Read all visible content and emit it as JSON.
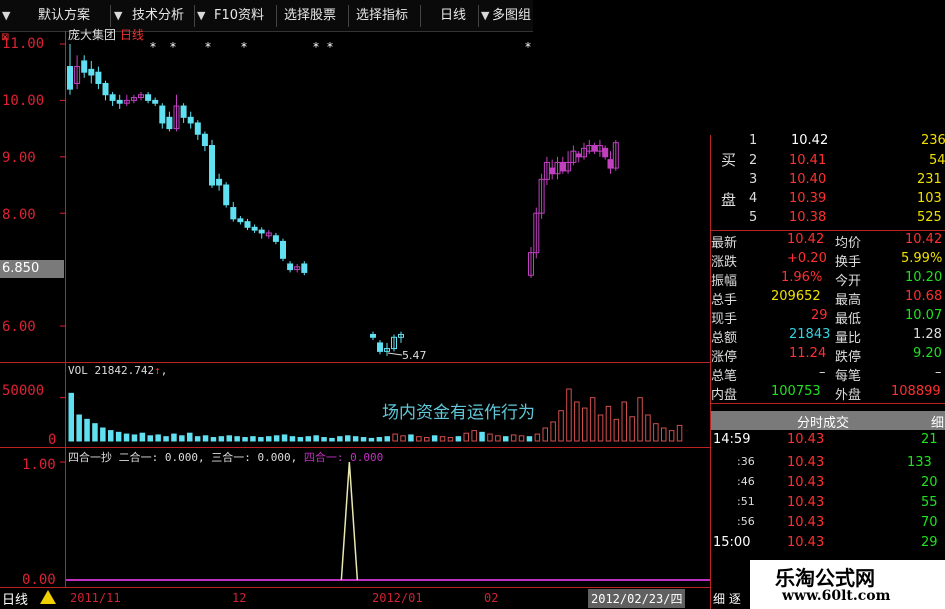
{
  "toolbar": {
    "items": [
      "默认方案",
      "技术分析",
      "F10资料",
      "选择股票",
      "选择指标",
      "日线",
      "多图组"
    ]
  },
  "stock": {
    "name": "庞大集团",
    "period": "日线"
  },
  "y_axis": {
    "labels": [
      "11.00",
      "10.00",
      "9.00",
      "8.00",
      "6.00"
    ],
    "current": "6.850"
  },
  "volume": {
    "label": "VOL 21842.742",
    "arrow": "↑",
    "comma": ",",
    "ylabels": [
      "50000",
      "0"
    ]
  },
  "indicator": {
    "title": "四合一抄",
    "f2": "二合一: 0.000,",
    "f3": "三合一: 0.000,",
    "f4": "四合一: 0.000",
    "ylabels": [
      "1.00",
      "0.00"
    ]
  },
  "annotation": "场内资金有运作行为",
  "low_label": "5.47",
  "bottom": {
    "tab": "日线",
    "dates": [
      "2011/11",
      "12",
      "2012/01",
      "02"
    ],
    "current_date": "2012/02/23/四"
  },
  "orderbook": {
    "buy_label_1": "买",
    "buy_label_2": "盘",
    "rows": [
      {
        "n": "1",
        "p": "10.42",
        "v": "236"
      },
      {
        "n": "2",
        "p": "10.41",
        "v": "54"
      },
      {
        "n": "3",
        "p": "10.40",
        "v": "231"
      },
      {
        "n": "4",
        "p": "10.39",
        "v": "103"
      },
      {
        "n": "5",
        "p": "10.38",
        "v": "525"
      }
    ]
  },
  "quote": [
    {
      "l1": "最新",
      "v1": "10.42",
      "l2": "均价",
      "v2": "10.42"
    },
    {
      "l1": "涨跌",
      "v1": "+0.20",
      "l2": "换手",
      "v2": "5.99%"
    },
    {
      "l1": "振幅",
      "v1": "1.96%",
      "l2": "今开",
      "v2": "10.20"
    },
    {
      "l1": "总手",
      "v1": "209652",
      "l2": "最高",
      "v2": "10.68"
    },
    {
      "l1": "现手",
      "v1": "29",
      "l2": "最低",
      "v2": "10.07"
    },
    {
      "l1": "总额",
      "v1": "21843",
      "l2": "量比",
      "v2": "1.28"
    },
    {
      "l1": "涨停",
      "v1": "11.24",
      "l2": "跌停",
      "v2": "9.20"
    },
    {
      "l1": "总笔",
      "v1": "–",
      "l2": "每笔",
      "v2": "–"
    },
    {
      "l1": "内盘",
      "v1": "100753",
      "l2": "外盘",
      "v2": "108899"
    }
  ],
  "trades_header": "分时成交",
  "trades_btn": "细",
  "trades": [
    {
      "t": "14:59",
      "p": "10.43",
      "v": "21"
    },
    {
      "t": ":36",
      "p": "10.43",
      "v": "133"
    },
    {
      "t": ":46",
      "p": "10.43",
      "v": "20"
    },
    {
      "t": ":51",
      "p": "10.43",
      "v": "55"
    },
    {
      "t": ":56",
      "p": "10.43",
      "v": "70"
    },
    {
      "t": "15:00",
      "p": "10.43",
      "v": "29"
    }
  ],
  "watermark": {
    "line1": "乐淘公式网",
    "line2": "www.60lt.com"
  },
  "foot": {
    "a": "细",
    "b": "逐"
  },
  "chart_data": {
    "type": "candlestick",
    "price_ylim": [
      5.0,
      11.0
    ],
    "candles": [
      {
        "o": 10.6,
        "c": 10.2,
        "h": 11.0,
        "l": 10.1
      },
      {
        "o": 10.3,
        "c": 10.6,
        "h": 10.8,
        "l": 10.2
      },
      {
        "o": 10.7,
        "c": 10.5,
        "h": 10.8,
        "l": 10.4
      },
      {
        "o": 10.55,
        "c": 10.45,
        "h": 10.7,
        "l": 10.3
      },
      {
        "o": 10.5,
        "c": 10.3,
        "h": 10.6,
        "l": 10.2
      },
      {
        "o": 10.3,
        "c": 10.1,
        "h": 10.35,
        "l": 10.0
      },
      {
        "o": 10.1,
        "c": 10.0,
        "h": 10.15,
        "l": 9.9
      },
      {
        "o": 10.0,
        "c": 9.95,
        "h": 10.1,
        "l": 9.85
      },
      {
        "o": 9.95,
        "c": 10.0,
        "h": 10.1,
        "l": 9.9
      },
      {
        "o": 10.0,
        "c": 10.05,
        "h": 10.1,
        "l": 9.95
      },
      {
        "o": 10.05,
        "c": 10.1,
        "h": 10.15,
        "l": 10.0
      },
      {
        "o": 10.1,
        "c": 10.0,
        "h": 10.15,
        "l": 9.95
      },
      {
        "o": 10.0,
        "c": 9.95,
        "h": 10.05,
        "l": 9.9
      },
      {
        "o": 9.9,
        "c": 9.6,
        "h": 9.95,
        "l": 9.5
      },
      {
        "o": 9.7,
        "c": 9.5,
        "h": 9.8,
        "l": 9.45
      },
      {
        "o": 9.5,
        "c": 9.9,
        "h": 10.1,
        "l": 9.45
      },
      {
        "o": 9.9,
        "c": 9.7,
        "h": 9.95,
        "l": 9.6
      },
      {
        "o": 9.7,
        "c": 9.6,
        "h": 9.8,
        "l": 9.5
      },
      {
        "o": 9.6,
        "c": 9.4,
        "h": 9.65,
        "l": 9.3
      },
      {
        "o": 9.4,
        "c": 9.2,
        "h": 9.45,
        "l": 9.1
      },
      {
        "o": 9.2,
        "c": 8.5,
        "h": 9.3,
        "l": 8.45
      },
      {
        "o": 8.6,
        "c": 8.5,
        "h": 8.7,
        "l": 8.4
      },
      {
        "o": 8.5,
        "c": 8.15,
        "h": 8.55,
        "l": 8.1
      },
      {
        "o": 8.1,
        "c": 7.9,
        "h": 8.2,
        "l": 7.85
      },
      {
        "o": 7.9,
        "c": 7.85,
        "h": 7.95,
        "l": 7.8
      },
      {
        "o": 7.85,
        "c": 7.75,
        "h": 7.9,
        "l": 7.7
      },
      {
        "o": 7.75,
        "c": 7.7,
        "h": 7.8,
        "l": 7.65
      },
      {
        "o": 7.7,
        "c": 7.65,
        "h": 7.75,
        "l": 7.55
      },
      {
        "o": 7.6,
        "c": 7.65,
        "h": 7.7,
        "l": 7.55
      },
      {
        "o": 7.6,
        "c": 7.5,
        "h": 7.65,
        "l": 7.45
      },
      {
        "o": 7.5,
        "c": 7.2,
        "h": 7.55,
        "l": 7.15
      },
      {
        "o": 7.1,
        "c": 7.0,
        "h": 7.15,
        "l": 6.95
      },
      {
        "o": 7.0,
        "c": 7.05,
        "h": 7.1,
        "l": 6.95
      },
      {
        "o": 7.1,
        "c": 6.95,
        "h": 7.15,
        "l": 6.9
      }
    ],
    "candles2": [
      {
        "o": 5.85,
        "c": 5.8,
        "h": 5.9,
        "l": 5.75
      },
      {
        "o": 5.7,
        "c": 5.55,
        "h": 5.75,
        "l": 5.5
      },
      {
        "o": 5.55,
        "c": 5.6,
        "h": 5.7,
        "l": 5.47
      },
      {
        "o": 5.6,
        "c": 5.8,
        "h": 5.85,
        "l": 5.55
      },
      {
        "o": 5.8,
        "c": 5.85,
        "h": 5.9,
        "l": 5.7
      }
    ],
    "candles3": [
      {
        "o": 6.9,
        "c": 7.3,
        "h": 7.4,
        "l": 6.85
      },
      {
        "o": 7.3,
        "c": 8.0,
        "h": 8.1,
        "l": 7.2
      },
      {
        "o": 8.0,
        "c": 8.6,
        "h": 8.7,
        "l": 7.9
      },
      {
        "o": 8.6,
        "c": 8.9,
        "h": 9.0,
        "l": 8.5
      },
      {
        "o": 8.8,
        "c": 8.7,
        "h": 8.95,
        "l": 8.6
      },
      {
        "o": 8.7,
        "c": 8.9,
        "h": 9.0,
        "l": 8.6
      },
      {
        "o": 8.9,
        "c": 8.75,
        "h": 9.0,
        "l": 8.7
      },
      {
        "o": 8.75,
        "c": 8.9,
        "h": 9.1,
        "l": 8.7
      },
      {
        "o": 8.9,
        "c": 9.1,
        "h": 9.2,
        "l": 8.85
      },
      {
        "o": 9.05,
        "c": 9.0,
        "h": 9.1,
        "l": 8.9
      },
      {
        "o": 9.0,
        "c": 9.15,
        "h": 9.25,
        "l": 8.95
      },
      {
        "o": 9.1,
        "c": 9.2,
        "h": 9.3,
        "l": 9.05
      },
      {
        "o": 9.2,
        "c": 9.1,
        "h": 9.25,
        "l": 9.05
      },
      {
        "o": 9.1,
        "c": 9.2,
        "h": 9.3,
        "l": 9.0
      },
      {
        "o": 9.15,
        "c": 9.0,
        "h": 9.2,
        "l": 8.95
      },
      {
        "o": 8.95,
        "c": 8.8,
        "h": 9.1,
        "l": 8.7
      },
      {
        "o": 8.8,
        "c": 9.25,
        "h": 9.3,
        "l": 8.75
      }
    ],
    "vol_ylim": [
      0,
      60000
    ],
    "volumes": [
      55000,
      30000,
      25000,
      20000,
      15000,
      12000,
      10000,
      8000,
      7000,
      9000,
      6000,
      7000,
      5000,
      8000,
      6000,
      9000,
      5000,
      6000,
      4000,
      5000,
      6000,
      5000,
      4000,
      5000,
      4000,
      5000,
      6000,
      7000,
      5000,
      4000,
      5000,
      6000,
      4000,
      3000,
      5000,
      6000,
      5000,
      4000,
      3000,
      4000,
      5000,
      8000,
      6000,
      7000,
      5000,
      4000,
      6000,
      5000,
      4000,
      5000,
      9000,
      12000,
      10000,
      8000,
      6000,
      5000,
      7000,
      6000,
      5000,
      8000,
      15000,
      22000,
      35000,
      60000,
      45000,
      38000,
      50000,
      30000,
      40000,
      25000,
      45000,
      28000,
      50000,
      30000,
      20000,
      15000,
      12000,
      18000
    ],
    "vol_colors": "cyan_then_red",
    "indicator_spike_at": 0.44
  }
}
